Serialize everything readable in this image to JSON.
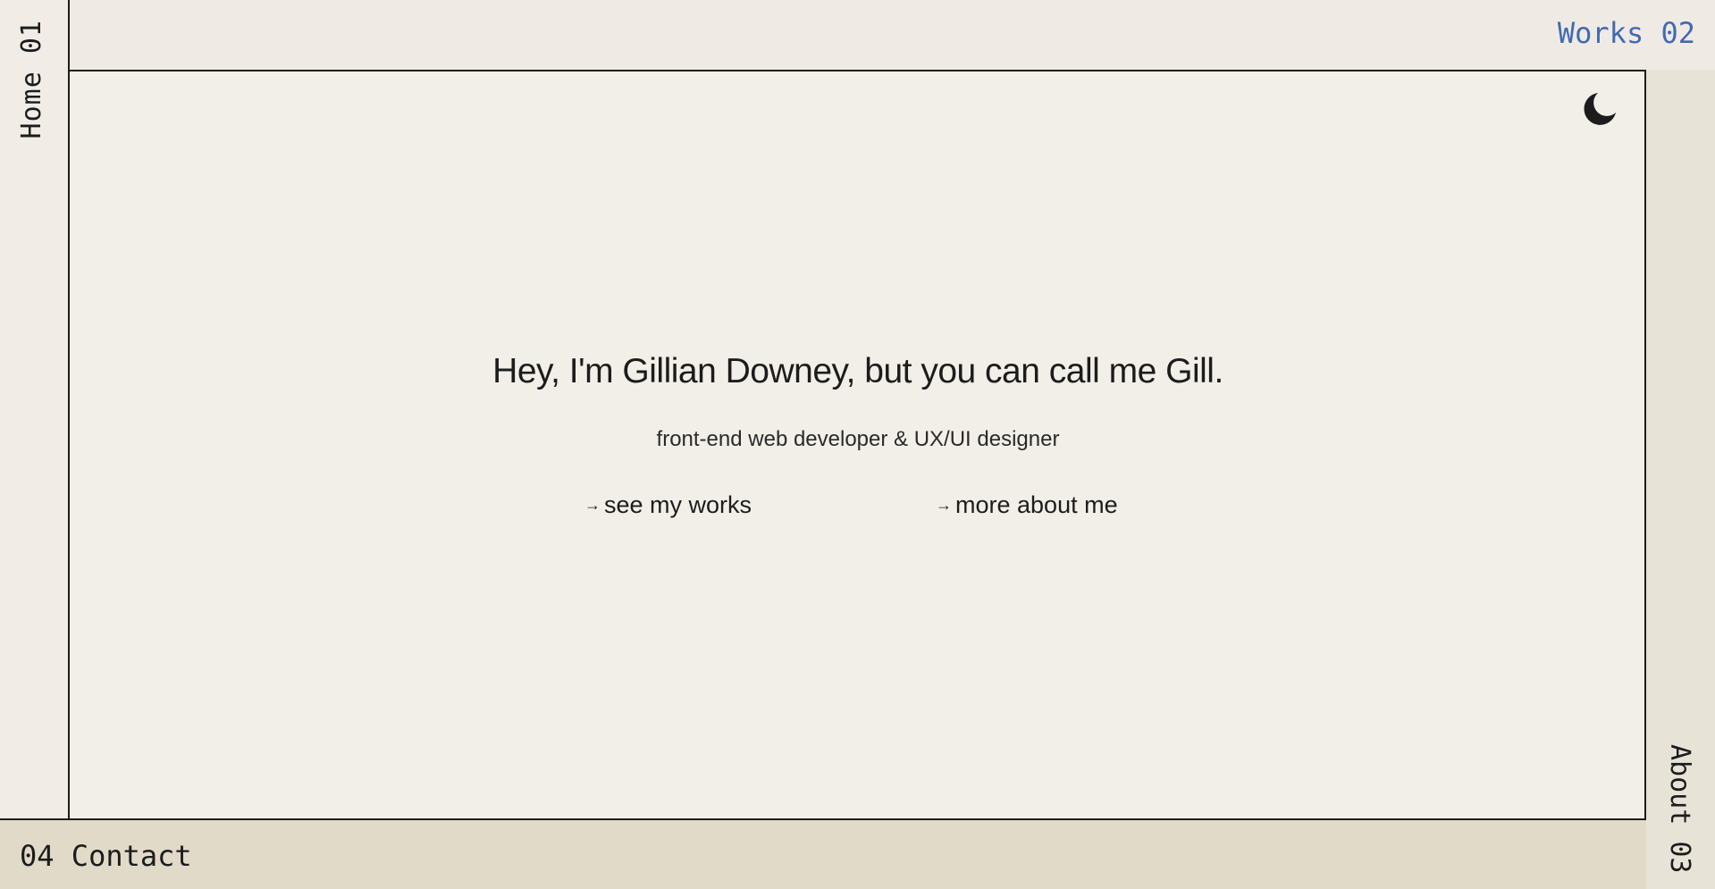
{
  "nav": {
    "home": "Home 01",
    "works": "Works 02",
    "about": "About 03",
    "contact": "04 Contact"
  },
  "theme_toggle": {
    "icon": "moon-icon"
  },
  "hero": {
    "title": "Hey, I'm Gillian Downey, but you can call me Gill.",
    "subtitle": "front-end web developer & UX/UI designer"
  },
  "cta": {
    "arrow": "→",
    "works_label": "see my works",
    "about_label": "more about me"
  },
  "colors": {
    "background": "#f1ede6",
    "works_accent": "#4369b3",
    "about_panel": "#e7e3d7",
    "contact_panel": "#e1dac9",
    "ink": "#1c1c1c"
  }
}
